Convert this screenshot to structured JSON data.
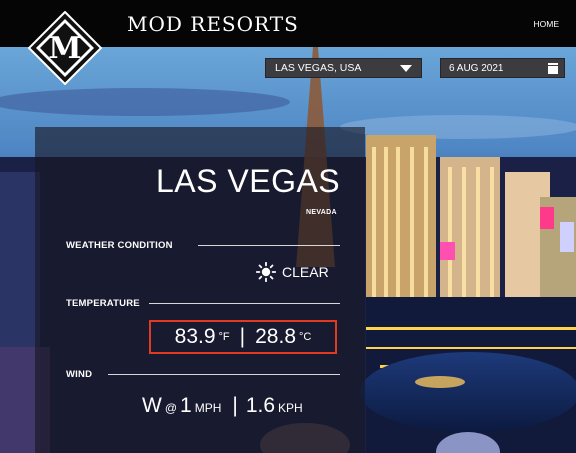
{
  "header": {
    "brand": "MOD RESORTS",
    "logo_letter": "M",
    "home_label": "HOME"
  },
  "filters": {
    "location": "LAS VEGAS, USA",
    "date": "6 AUG 2021"
  },
  "weather": {
    "city": "LAS VEGAS",
    "state": "NEVADA",
    "condition_label": "WEATHER CONDITION",
    "condition": "CLEAR",
    "condition_icon": "sun-icon",
    "temperature_label": "TEMPERATURE",
    "temp_f": "83.9",
    "unit_f": "°F",
    "temp_c": "28.8",
    "unit_c": "°C",
    "temp_separator": "|",
    "wind_label": "WIND",
    "wind_direction": "W",
    "wind_at": "@",
    "wind_mph": "1",
    "unit_mph": "MPH",
    "wind_separator": "|",
    "wind_kph": "1.6",
    "unit_kph": "KPH"
  },
  "colors": {
    "header_bg": "#050505",
    "highlight_border": "#e23a22",
    "select_bg": "#3b3b40"
  }
}
